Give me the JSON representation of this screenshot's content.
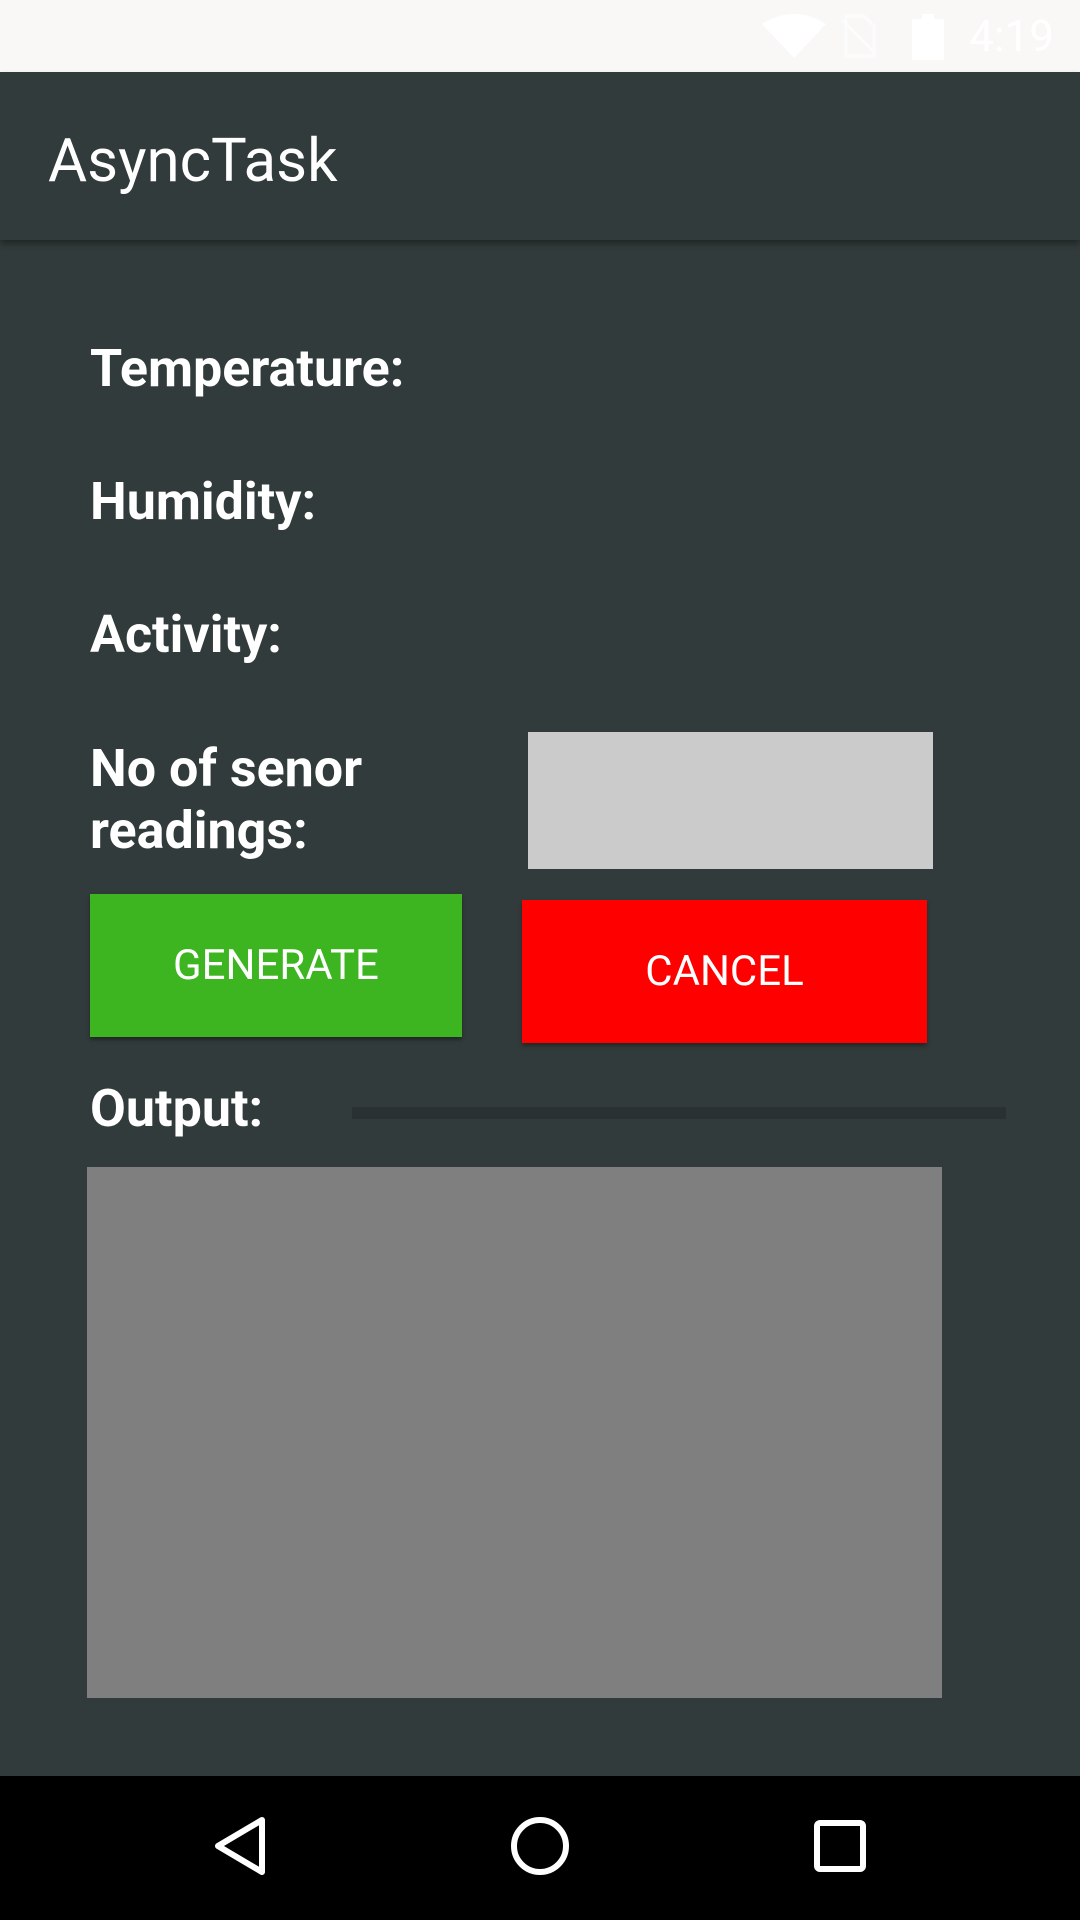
{
  "status_bar": {
    "time": "4:19",
    "icons": [
      "wifi-icon",
      "no-sim-icon",
      "battery-icon"
    ]
  },
  "app_bar": {
    "title": "AsyncTask"
  },
  "form": {
    "temperature_label": "Temperature:",
    "humidity_label": "Humidity:",
    "activity_label": "Activity:",
    "readings_label_line1": "No of senor",
    "readings_label_line2": "readings:",
    "readings_value": "",
    "generate_label": "GENERATE",
    "cancel_label": "CANCEL",
    "output_label": "Output:",
    "output_text": "",
    "progress": 0
  },
  "colors": {
    "background": "#323b3b",
    "generate_button": "#3cb521",
    "cancel_button": "#ff0000",
    "input_background": "#cbcbcb",
    "output_background": "#7f7f7f"
  },
  "nav_bar": {
    "icons": [
      "back-icon",
      "home-icon",
      "recents-icon"
    ]
  }
}
